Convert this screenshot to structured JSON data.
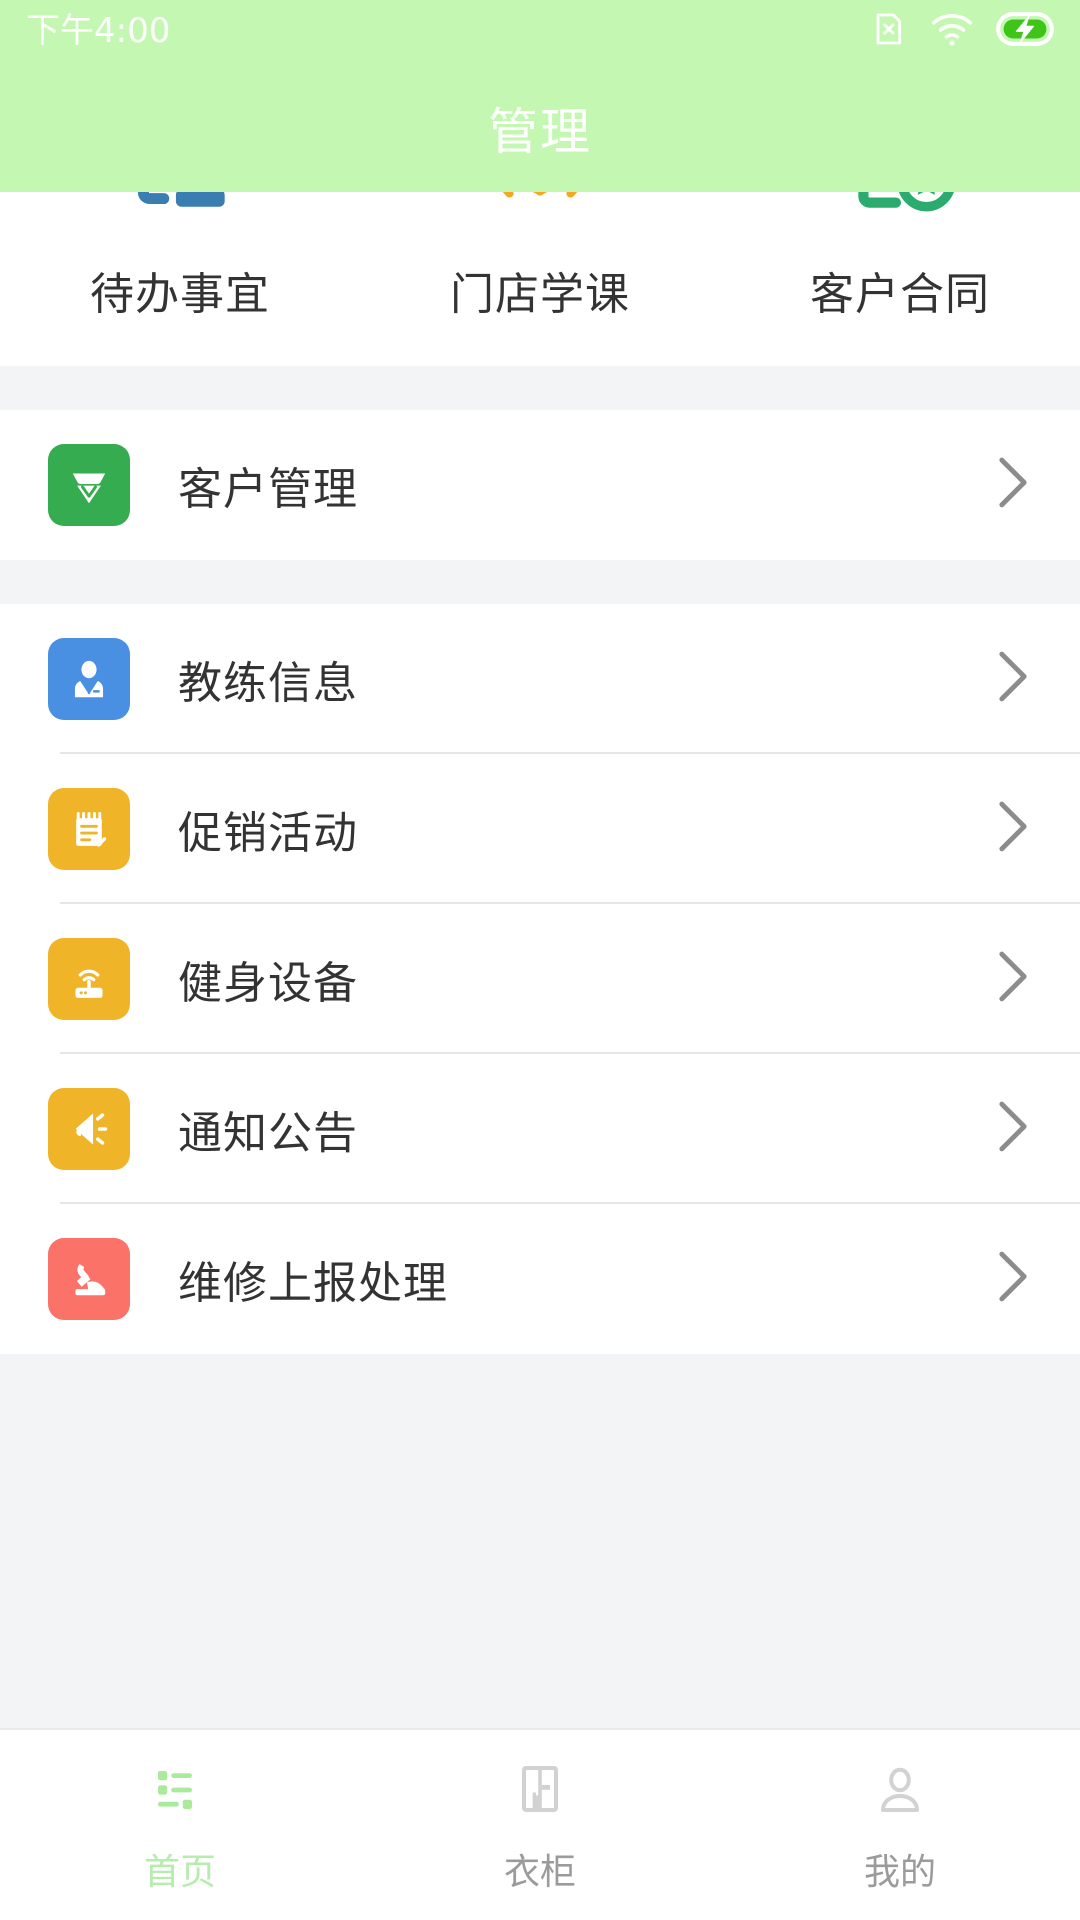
{
  "statusbar": {
    "time": "下午4:00",
    "icons": [
      {
        "name": "sim-card-x-icon"
      },
      {
        "name": "wifi-icon"
      },
      {
        "name": "battery-charging-icon"
      }
    ]
  },
  "header": {
    "title": "管理",
    "bg_color": "#c4f8b2",
    "title_color": "#ffffff"
  },
  "shortcuts": [
    {
      "label": "待办事宜",
      "icon": "document-stamp-icon",
      "color": "#3a7db0"
    },
    {
      "label": "门店学课",
      "icon": "open-book-icon",
      "color": "#f5a623"
    },
    {
      "label": "客户合同",
      "icon": "contract-star-icon",
      "color": "#2bab6e"
    }
  ],
  "groups": [
    {
      "rows": [
        {
          "label": "客户管理",
          "icon": "customer-shield-icon",
          "color": "#34ac4f"
        }
      ]
    },
    {
      "rows": [
        {
          "label": "教练信息",
          "icon": "coach-person-icon",
          "color": "#4a90e2"
        },
        {
          "label": "促销活动",
          "icon": "promotion-notepad-icon",
          "color": "#f0b429"
        },
        {
          "label": "健身设备",
          "icon": "fitness-device-icon",
          "color": "#f0b429"
        },
        {
          "label": "通知公告",
          "icon": "announcement-megaphone-icon",
          "color": "#f0b429"
        },
        {
          "label": "维修上报处理",
          "icon": "repair-tool-icon",
          "color": "#fa7268"
        }
      ]
    }
  ],
  "chevron_color": "#8c8c8c",
  "tabs": [
    {
      "label": "首页",
      "icon": "list-home-icon",
      "active": true,
      "color": "#b6ecae"
    },
    {
      "label": "衣柜",
      "icon": "locker-icon",
      "active": false,
      "color": "#bfbfbf"
    },
    {
      "label": "我的",
      "icon": "person-icon",
      "active": false,
      "color": "#bfbfbf"
    }
  ]
}
